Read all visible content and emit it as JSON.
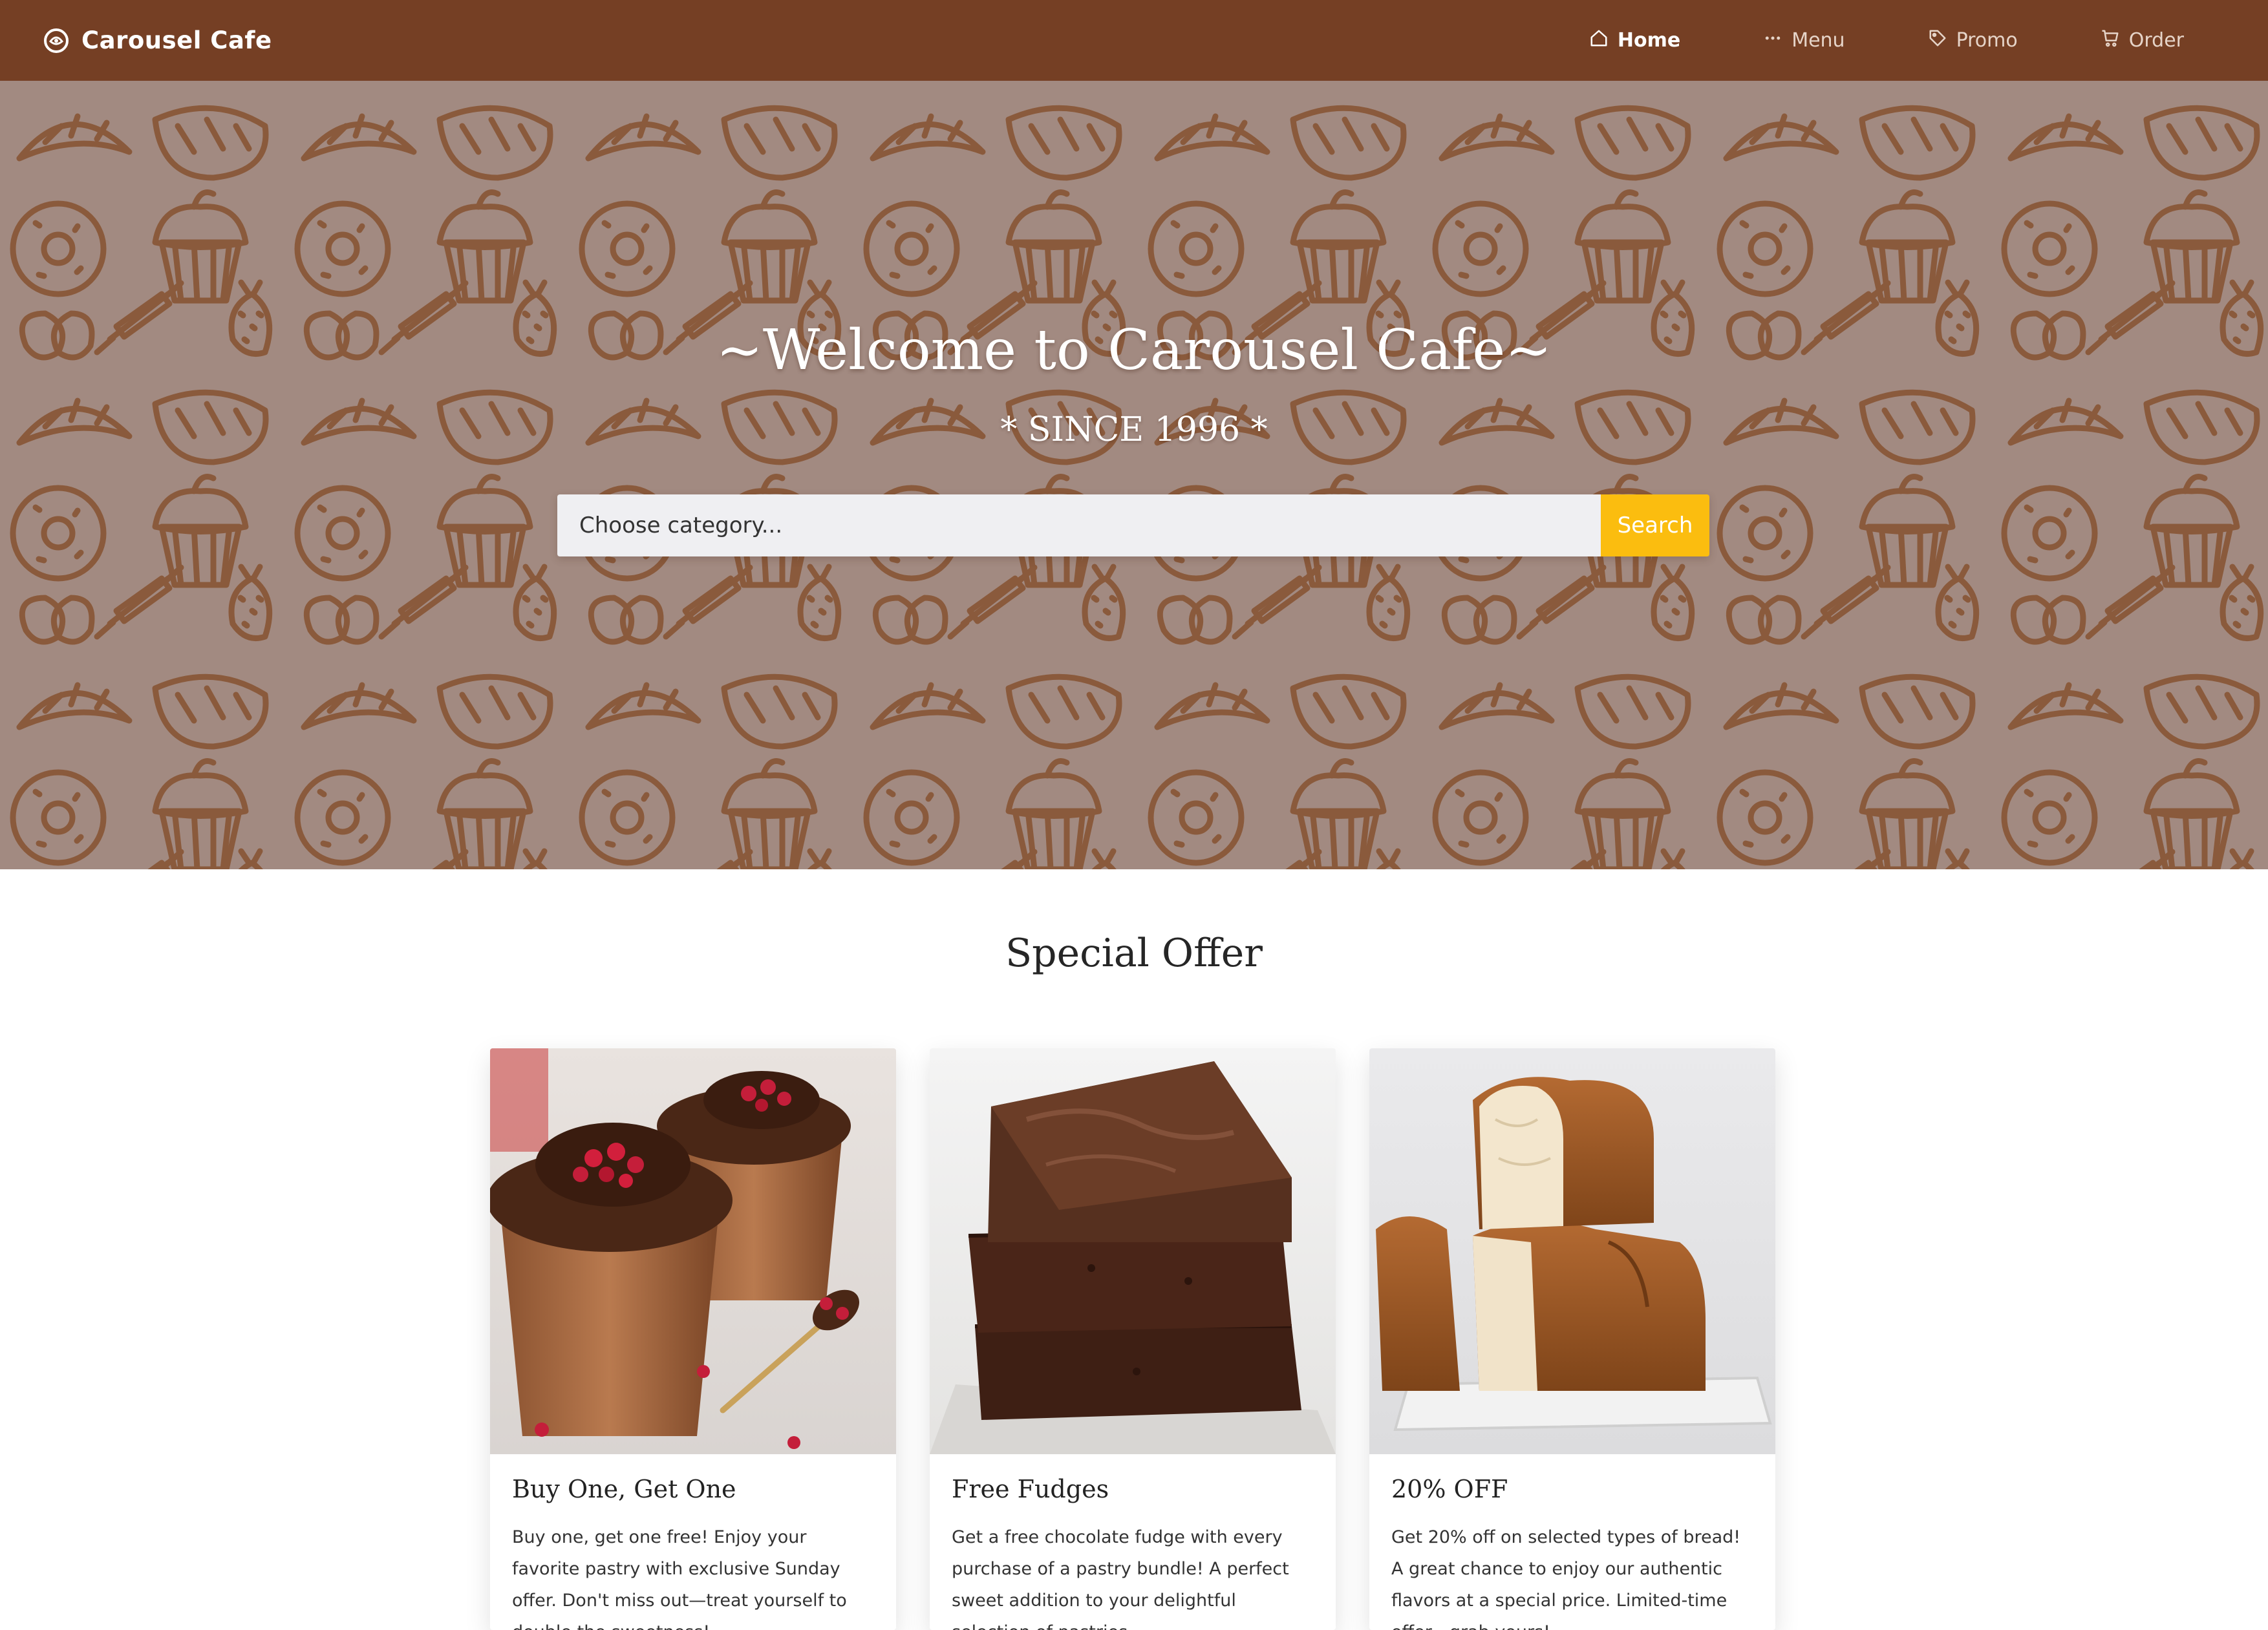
{
  "brand": {
    "name": "Carousel Cafe"
  },
  "nav": {
    "items": [
      {
        "label": "Home",
        "icon": "home-icon",
        "active": true
      },
      {
        "label": "Menu",
        "icon": "more-dots-icon",
        "active": false
      },
      {
        "label": "Promo",
        "icon": "tag-icon",
        "active": false
      },
      {
        "label": "Order",
        "icon": "cart-icon",
        "active": false
      }
    ]
  },
  "hero": {
    "title": "~Welcome to Carousel Cafe~",
    "subtitle": "* SINCE 1996 *",
    "search": {
      "placeholder": "Choose category...",
      "value": "",
      "button_label": "Search"
    }
  },
  "special_offer": {
    "title": "Special Offer",
    "cards": [
      {
        "title": "Buy One, Get One",
        "text": "Buy one, get one free! Enjoy your favorite pastry with exclusive Sunday offer. Don't miss out—treat yourself to double the sweetness!",
        "image": "chocolate-mousse-cups-image"
      },
      {
        "title": "Free Fudges",
        "text": "Get a free chocolate fudge with every purchase of a pastry bundle! A perfect sweet addition to your delightful selection of pastries.",
        "image": "stacked-brownies-image"
      },
      {
        "title": "20% OFF",
        "text": "Get 20% off on selected types of bread! A great chance to enjoy our authentic flavors at a special price. Limited-time offer—grab yours!",
        "image": "milk-bread-loaves-image"
      }
    ]
  },
  "colors": {
    "navbar": "#753f24",
    "hero_bg": "#a28a81",
    "hero_pattern": "#8a5a3c",
    "accent_button": "#fbbd0f"
  }
}
